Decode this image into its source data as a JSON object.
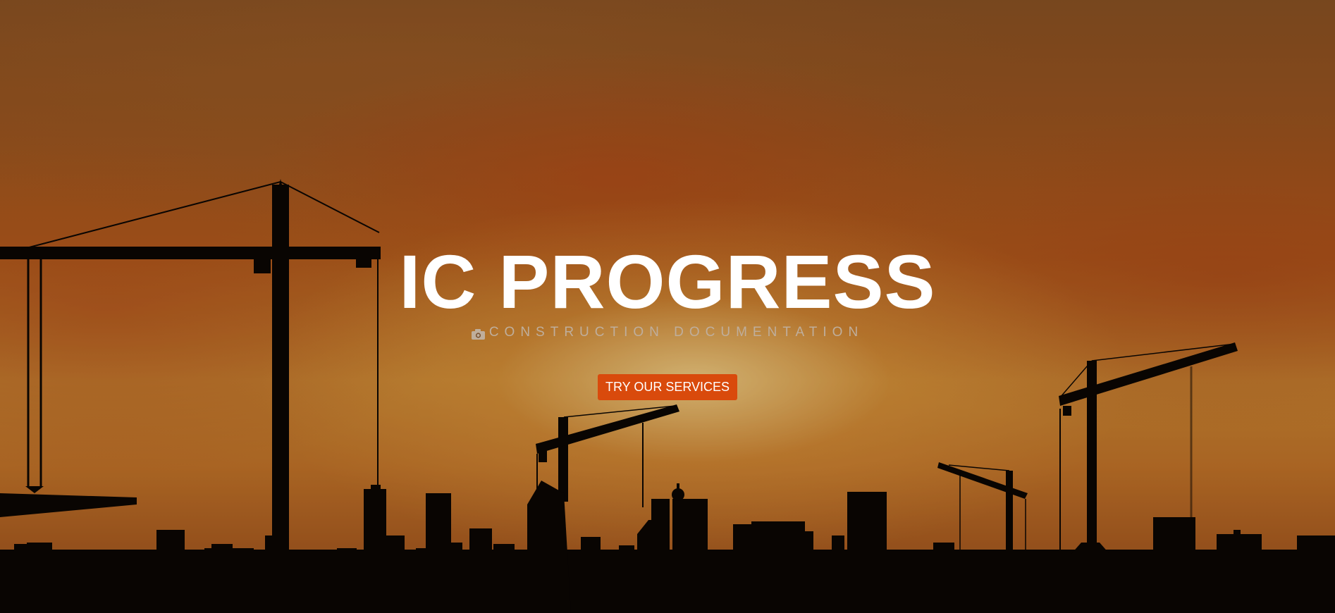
{
  "hero": {
    "title": "IC PROGRESS",
    "subtitle": "CONSTRUCTION DOCUMENTATION",
    "cta_label": "TRY OUR SERVICES",
    "subtitle_icon": "camera-icon"
  },
  "colors": {
    "cta_background": "#d94a0c",
    "title_text": "#ffffff",
    "subtitle_text": "#bfae9c",
    "silhouette": "#050302"
  }
}
